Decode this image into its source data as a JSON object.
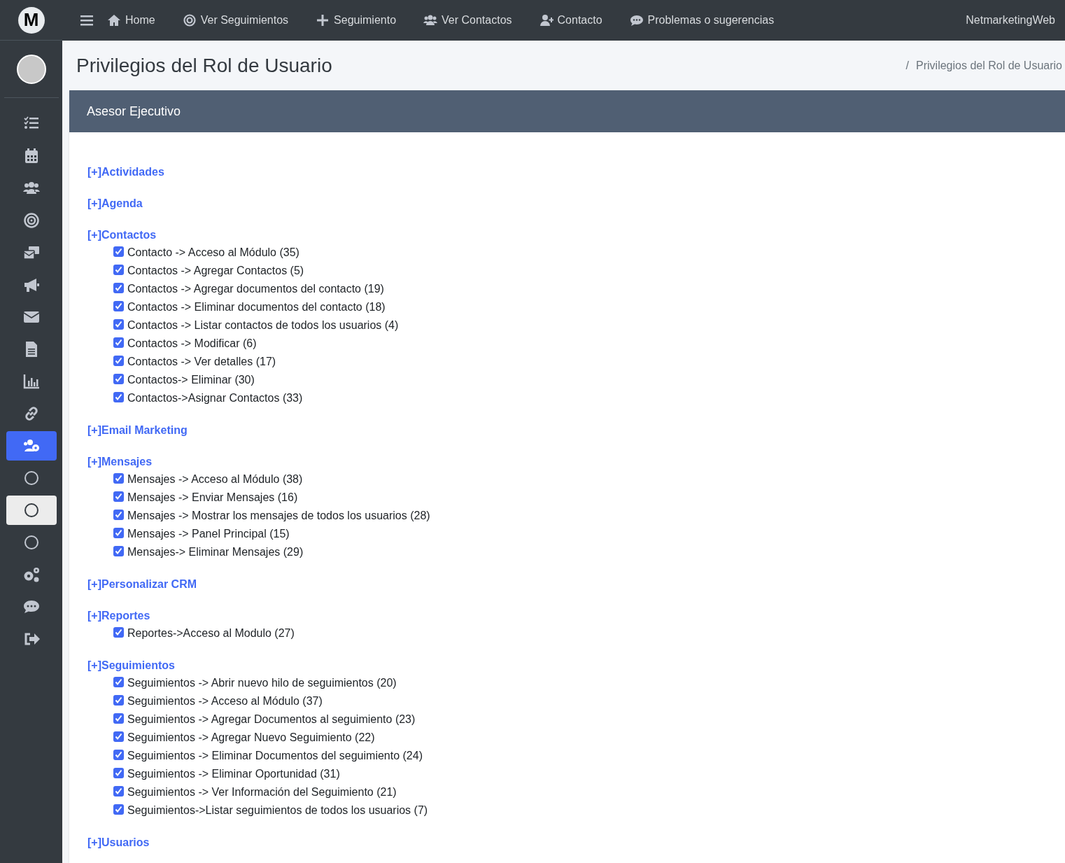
{
  "brand": {
    "logo": "M"
  },
  "topnav": {
    "items": [
      {
        "label": "Home"
      },
      {
        "label": "Ver Seguimientos"
      },
      {
        "label": "Seguimiento"
      },
      {
        "label": "Ver Contactos"
      },
      {
        "label": "Contacto"
      },
      {
        "label": "Problemas o sugerencias"
      }
    ],
    "site_name": "NetmarketingWeb"
  },
  "sidebar": {
    "items": [
      {
        "selected": false,
        "highlighted": false
      },
      {
        "selected": false,
        "highlighted": false
      },
      {
        "selected": false,
        "highlighted": false
      },
      {
        "selected": false,
        "highlighted": false
      },
      {
        "selected": false,
        "highlighted": false
      },
      {
        "selected": false,
        "highlighted": false
      },
      {
        "selected": false,
        "highlighted": false
      },
      {
        "selected": false,
        "highlighted": false
      },
      {
        "selected": false,
        "highlighted": false
      },
      {
        "selected": false,
        "highlighted": false
      },
      {
        "selected": true,
        "highlighted": false
      },
      {
        "selected": false,
        "highlighted": false
      },
      {
        "selected": false,
        "highlighted": true
      },
      {
        "selected": false,
        "highlighted": false
      },
      {
        "selected": false,
        "highlighted": false
      },
      {
        "selected": false,
        "highlighted": false
      },
      {
        "selected": false,
        "highlighted": false
      }
    ]
  },
  "page_title": "Privilegios del Rol de Usuario",
  "breadcrumb": {
    "separator": "/",
    "current": "Privilegios del Rol de Usuario"
  },
  "card": {
    "title": "Asesor Ejecutivo",
    "sections": [
      {
        "title": "[+]Actividades"
      },
      {
        "title": "[+]Agenda"
      },
      {
        "title": "[+]Contactos",
        "permissions": [
          {
            "label": "Contacto -> Acceso al Módulo (35)",
            "checked": true
          },
          {
            "label": "Contactos -> Agregar Contactos (5)",
            "checked": true
          },
          {
            "label": "Contactos -> Agregar documentos del contacto (19)",
            "checked": true
          },
          {
            "label": "Contactos -> Eliminar documentos del contacto (18)",
            "checked": true
          },
          {
            "label": "Contactos -> Listar contactos de todos los usuarios (4)",
            "checked": true
          },
          {
            "label": "Contactos -> Modificar (6)",
            "checked": true
          },
          {
            "label": "Contactos -> Ver detalles (17)",
            "checked": true
          },
          {
            "label": "Contactos-> Eliminar (30)",
            "checked": true
          },
          {
            "label": "Contactos->Asignar Contactos (33)",
            "checked": true
          }
        ]
      },
      {
        "title": "[+]Email Marketing"
      },
      {
        "title": "[+]Mensajes",
        "permissions": [
          {
            "label": "Mensajes -> Acceso al Módulo (38)",
            "checked": true
          },
          {
            "label": "Mensajes -> Enviar Mensajes (16)",
            "checked": true
          },
          {
            "label": "Mensajes -> Mostrar los mensajes de todos los usuarios (28)",
            "checked": true
          },
          {
            "label": "Mensajes -> Panel Principal (15)",
            "checked": true
          },
          {
            "label": "Mensajes-> Eliminar Mensajes (29)",
            "checked": true
          }
        ]
      },
      {
        "title": "[+]Personalizar CRM"
      },
      {
        "title": "[+]Reportes",
        "permissions": [
          {
            "label": "Reportes->Acceso al Modulo (27)",
            "checked": true
          }
        ]
      },
      {
        "title": "[+]Seguimientos",
        "permissions": [
          {
            "label": "Seguimientos -> Abrir nuevo hilo de seguimientos (20)",
            "checked": true
          },
          {
            "label": "Seguimientos -> Acceso al Módulo (37)",
            "checked": true
          },
          {
            "label": "Seguimientos -> Agregar Documentos al seguimiento (23)",
            "checked": true
          },
          {
            "label": "Seguimientos -> Agregar Nuevo Seguimiento (22)",
            "checked": true
          },
          {
            "label": "Seguimientos -> Eliminar Documentos del seguimiento (24)",
            "checked": true
          },
          {
            "label": "Seguimientos -> Eliminar Oportunidad (31)",
            "checked": true
          },
          {
            "label": "Seguimientos -> Ver Información del Seguimiento (21)",
            "checked": true
          },
          {
            "label": "Seguimientos->Listar seguimientos de todos los usuarios (7)",
            "checked": true
          }
        ]
      },
      {
        "title": "[+]Usuarios"
      }
    ]
  }
}
